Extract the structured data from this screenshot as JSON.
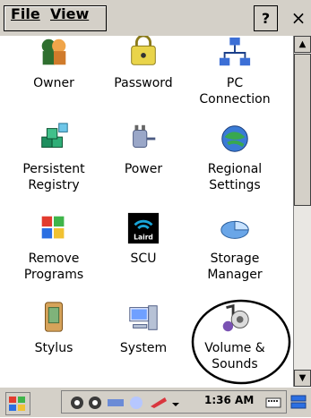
{
  "menubar": {
    "file_label": "File",
    "view_label": "View",
    "help_label": "?",
    "close_label": "×"
  },
  "items": [
    {
      "label": "Owner",
      "icon": "owner-icon"
    },
    {
      "label": "Password",
      "icon": "password-icon"
    },
    {
      "label": "PC\nConnection",
      "icon": "pc-connection-icon"
    },
    {
      "label": "Persistent\nRegistry",
      "icon": "persistent-registry-icon"
    },
    {
      "label": "Power",
      "icon": "power-icon"
    },
    {
      "label": "Regional\nSettings",
      "icon": "regional-settings-icon"
    },
    {
      "label": "Remove\nPrograms",
      "icon": "remove-programs-icon"
    },
    {
      "label": "SCU",
      "icon": "scu-icon"
    },
    {
      "label": "Storage\nManager",
      "icon": "storage-manager-icon"
    },
    {
      "label": "Stylus",
      "icon": "stylus-icon"
    },
    {
      "label": "System",
      "icon": "system-icon"
    },
    {
      "label": "Volume &\nSounds",
      "icon": "volume-sounds-icon"
    }
  ],
  "scu_icon_text": "Laird",
  "taskbar": {
    "clock": "1:36 AM",
    "tray_icons": [
      "network-icon",
      "network-icon",
      "usb-icon",
      "bluetooth-icon",
      "sync-icon",
      "arrow-icon"
    ]
  }
}
